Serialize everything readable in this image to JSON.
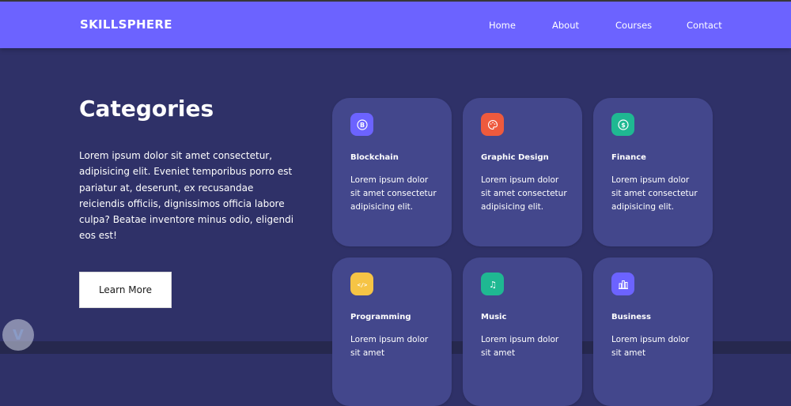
{
  "brand": "SKILLSPHERE",
  "nav": [
    {
      "label": "Home"
    },
    {
      "label": "About"
    },
    {
      "label": "Courses"
    },
    {
      "label": "Contact"
    }
  ],
  "hero": {
    "title": "Categories",
    "text": "Lorem ipsum dolor sit amet consectetur, adipisicing elit. Eveniet temporibus porro est pariatur at, deserunt, ex recusandae reiciendis officiis, dignissimos officia labore culpa? Beatae inventore minus odio, eligendi eos est!",
    "button_label": "Learn More"
  },
  "categories": [
    {
      "title": "Blockchain",
      "text": "Lorem ipsum dolor sit amet consectetur adipisicing elit.",
      "icon": "bitcoin-icon",
      "glyph": "B",
      "color": "#6c63ff"
    },
    {
      "title": "Graphic Design",
      "text": "Lorem ipsum dolor sit amet consectetur adipisicing elit.",
      "icon": "palette-icon",
      "glyph": "",
      "color": "#ee5a3d"
    },
    {
      "title": "Finance",
      "text": "Lorem ipsum dolor sit amet consectetur adipisicing elit.",
      "icon": "dollar-coin-icon",
      "glyph": "$",
      "color": "#1fb892"
    },
    {
      "title": "Programming",
      "text": "Lorem ipsum dolor sit amet",
      "icon": "code-icon",
      "glyph": "</>",
      "color": "#f6c445"
    },
    {
      "title": "Music",
      "text": "Lorem ipsum dolor sit amet",
      "icon": "music-note-icon",
      "glyph": "♫",
      "color": "#1fb892"
    },
    {
      "title": "Business",
      "text": "Lorem ipsum dolor sit amet",
      "icon": "bar-chart-icon",
      "glyph": "",
      "color": "#6c63ff"
    }
  ],
  "colors": {
    "navbar": "#6c63ff",
    "background": "#2f3168",
    "card": "#43478c"
  }
}
